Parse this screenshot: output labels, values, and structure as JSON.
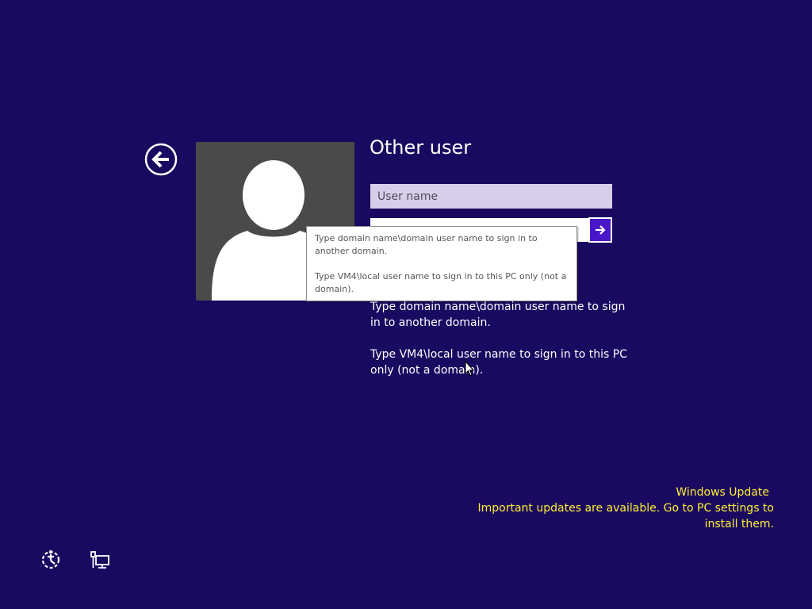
{
  "login": {
    "title": "Other user",
    "username_placeholder": "User name",
    "username_value": "",
    "password_value": "",
    "hint_line1": "Type domain name\\domain user name to sign in to another domain.",
    "hint_line2": "Type VM4\\local user name to sign in to this PC only (not a domain)."
  },
  "tooltip": {
    "line1": "Type domain name\\domain user name to sign in to another domain.",
    "line2": "Type VM4\\local user name to sign in to this PC only (not a domain)."
  },
  "update_notice": {
    "title": "Windows Update",
    "message": "Important updates are available. Go to PC settings to install them."
  },
  "icons": {
    "back": "back-arrow-icon",
    "submit": "right-arrow-icon",
    "ease_of_access": "ease-of-access-icon",
    "network": "network-icon",
    "avatar": "user-silhouette-icon"
  },
  "colors": {
    "background": "#1a0960",
    "username_field": "#d7cfe9",
    "submit_button": "#4a17c8",
    "notice_text": "#ffee33",
    "avatar_tile": "#4a4a4a"
  }
}
